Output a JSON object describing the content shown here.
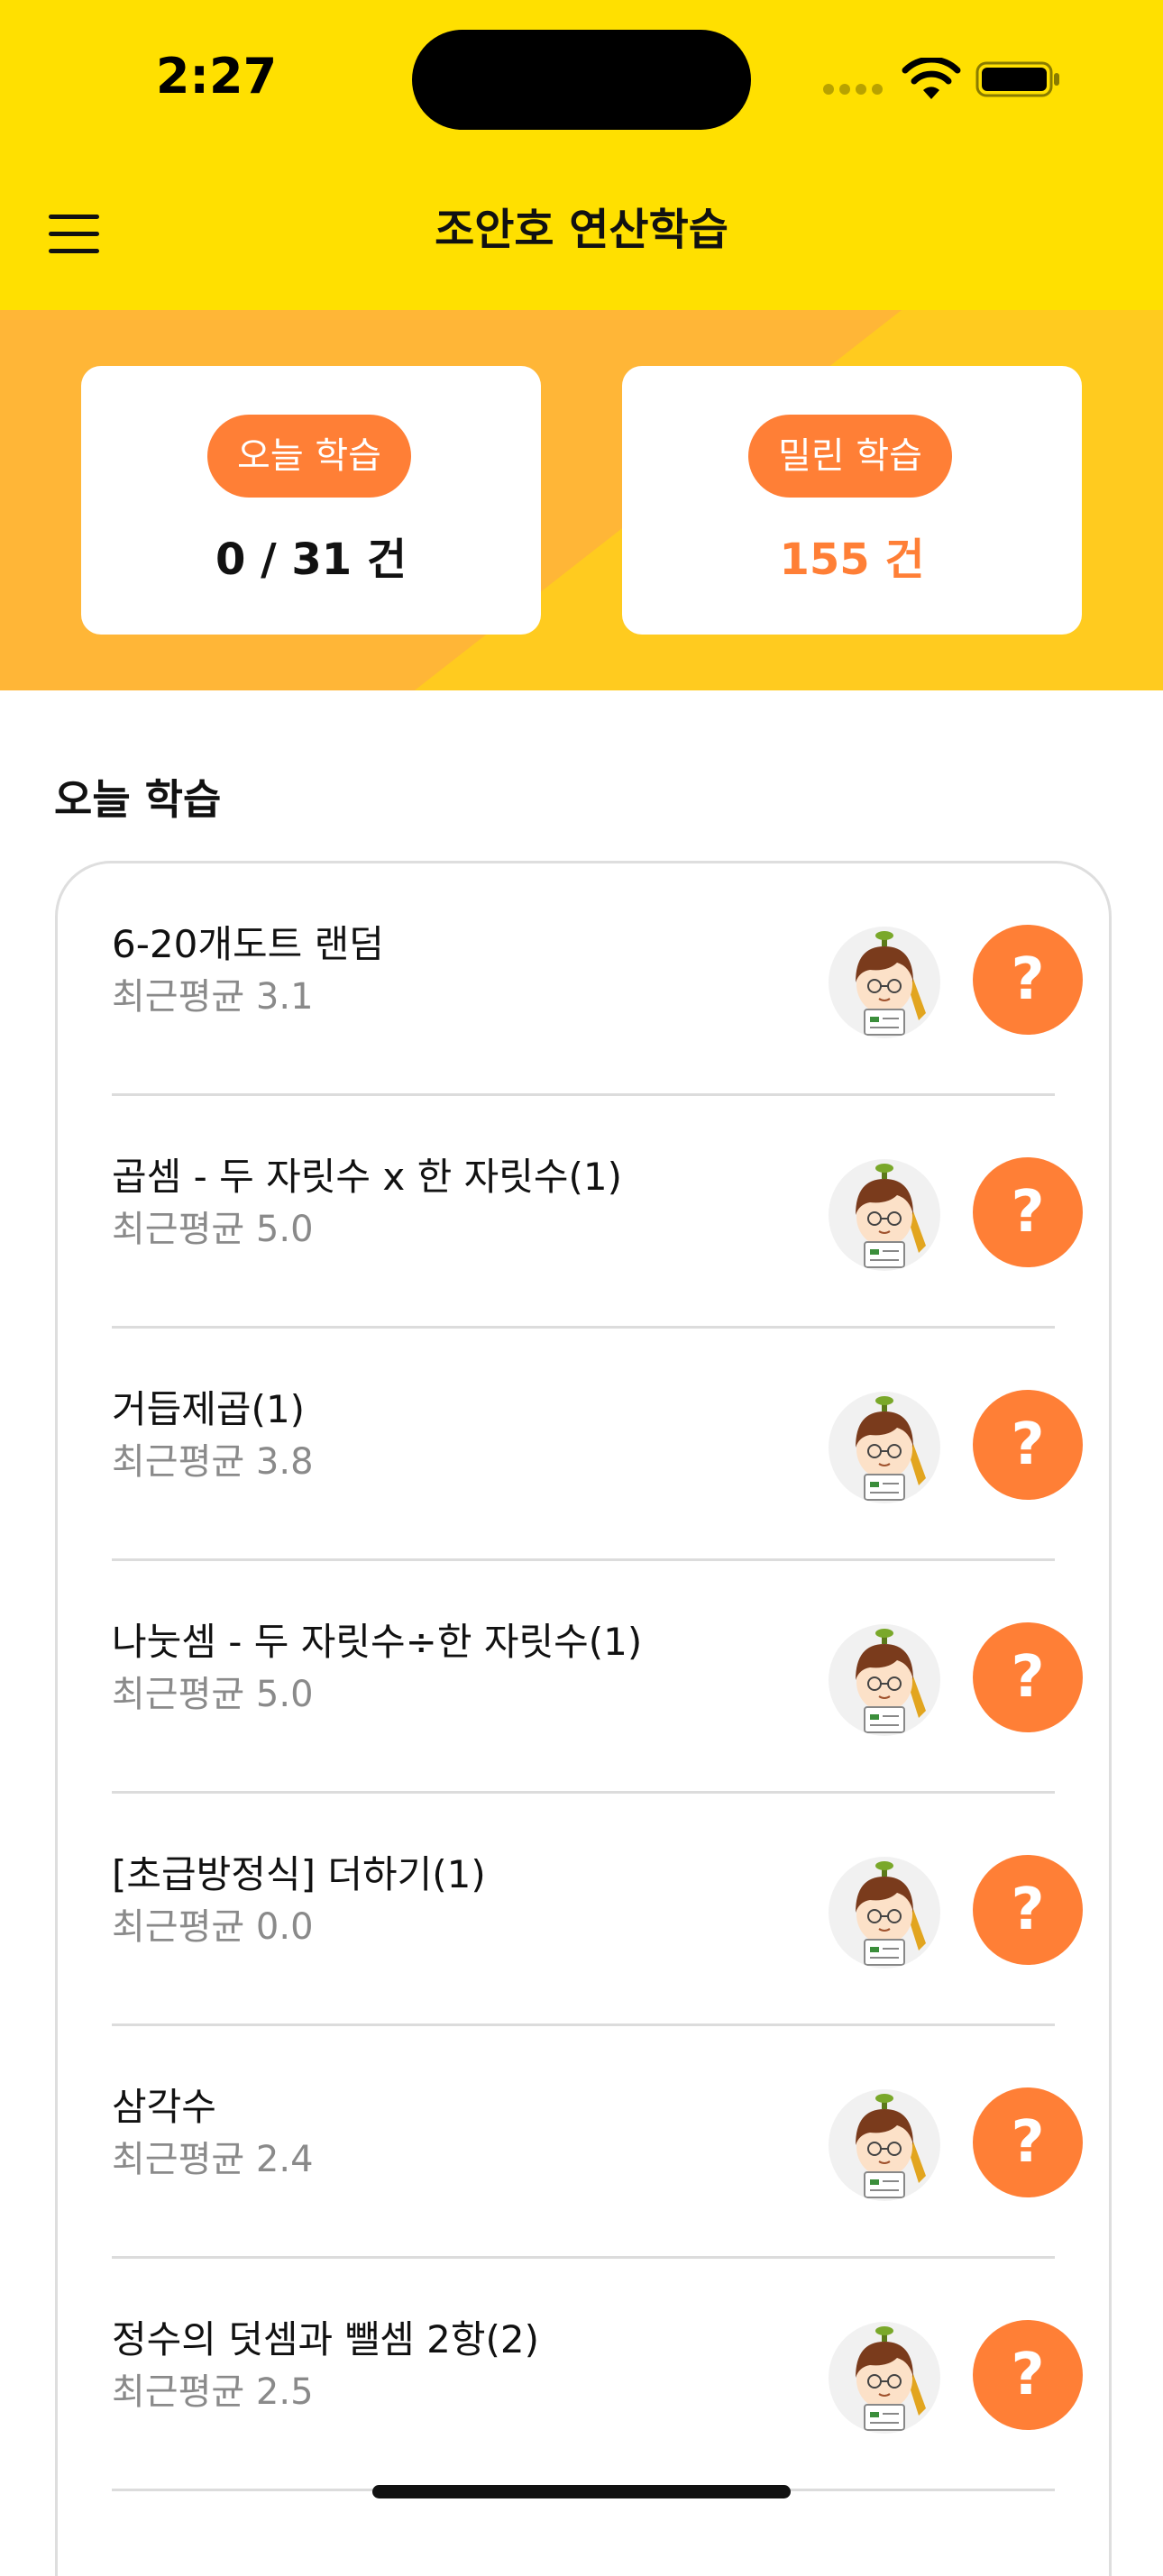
{
  "status_bar": {
    "time": "2:27"
  },
  "nav": {
    "title": "조안호 연산학습",
    "menu_icon": "hamburger-menu-icon"
  },
  "summary": {
    "today": {
      "label": "오늘 학습",
      "value": "0 / 31 건"
    },
    "overdue": {
      "label": "밀린 학습",
      "value": "155 건"
    }
  },
  "section": {
    "title": "오늘 학습"
  },
  "items": [
    {
      "title": "6-20개도트 랜덤",
      "avg": "최근평균 3.1",
      "help": "?"
    },
    {
      "title": "곱셈 - 두 자릿수 x 한 자릿수(1)",
      "avg": "최근평균 5.0",
      "help": "?"
    },
    {
      "title": "거듭제곱(1)",
      "avg": "최근평균 3.8",
      "help": "?"
    },
    {
      "title": "나눗셈 - 두 자릿수÷한 자릿수(1)",
      "avg": "최근평균 5.0",
      "help": "?"
    },
    {
      "title": "[초급방정식] 더하기(1)",
      "avg": "최근평균 0.0",
      "help": "?"
    },
    {
      "title": "삼각수",
      "avg": "최근평균 2.4",
      "help": "?"
    },
    {
      "title": "정수의 덧셈과 뺄셈 2항(2)",
      "avg": "최근평균 2.5",
      "help": "?"
    }
  ],
  "colors": {
    "header_yellow": "#FFE000",
    "band_yellow": "#FFCB1F",
    "band_orange": "#FFB637",
    "accent_orange": "#FF7F36",
    "muted_text": "#8a8a8a"
  }
}
